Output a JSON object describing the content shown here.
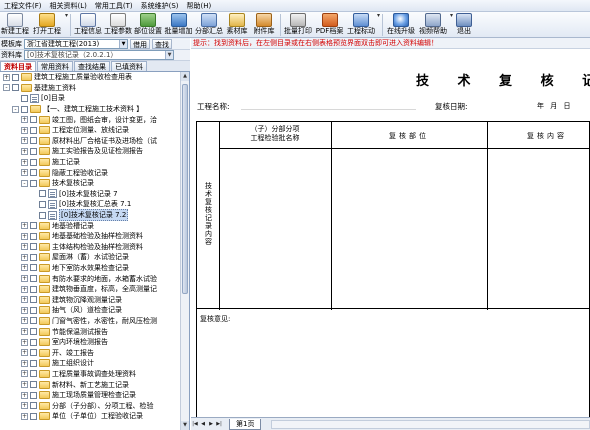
{
  "menu": [
    "工程文件(F)",
    "相关资料(L)",
    "常用工具(T)",
    "系统维护(S)",
    "帮助(H)"
  ],
  "toolbar": {
    "new_project": "新建工程",
    "open_project": "打开工程",
    "project_info": "工程信息",
    "project_params": "工程参数",
    "dept_settings": "部位设置",
    "batch_add": "批量增加",
    "sub_summary": "分部汇总",
    "material_lib": "素材库",
    "attachment_lib": "附件库",
    "batch_print": "批量打印",
    "pdf_archive": "PDF档案",
    "project_mark": "工程标动",
    "online_upgrade": "在线升级",
    "video_help": "视频帮助",
    "exit": "退出"
  },
  "left": {
    "template_label": "模板库",
    "template_value": "浙江省建筑工程(2013)",
    "template_button": "借用",
    "find_button": "查找",
    "library_label": "资料库",
    "library_value": "[0]技术复核记录（2.0.2.1）",
    "tabs": [
      "资料目录",
      "常用资料",
      "查找结果",
      "已填资料"
    ],
    "tree": [
      {
        "label": "建筑工程施工质量验收检查用表",
        "indent": 0,
        "type": "folder",
        "exp": "+"
      },
      {
        "label": "基建施工资料",
        "indent": 0,
        "type": "folder",
        "exp": "-"
      },
      {
        "label": "[0]目录",
        "indent": 1,
        "type": "doc",
        "exp": ""
      },
      {
        "label": "【一、建筑工程施工技术资料 】",
        "indent": 1,
        "type": "folder",
        "exp": "-"
      },
      {
        "label": "竣工图，图纸会审，设计变更，洽",
        "indent": 2,
        "type": "folder",
        "exp": "+"
      },
      {
        "label": "工程定位测量、放线记录",
        "indent": 2,
        "type": "folder",
        "exp": "+"
      },
      {
        "label": "原材料出厂合格证书及进场检（试",
        "indent": 2,
        "type": "folder",
        "exp": "+"
      },
      {
        "label": "施工实验报告及见证检测报告",
        "indent": 2,
        "type": "folder",
        "exp": "+"
      },
      {
        "label": "施工记录",
        "indent": 2,
        "type": "folder",
        "exp": "+"
      },
      {
        "label": "隐蔽工程验收记录",
        "indent": 2,
        "type": "folder",
        "exp": "+"
      },
      {
        "label": "技术复核记录",
        "indent": 2,
        "type": "folder",
        "exp": "-"
      },
      {
        "label": "[0]技术复核记录 7",
        "indent": 3,
        "type": "doc",
        "exp": ""
      },
      {
        "label": "[0]技术复核汇总表 7.1",
        "indent": 3,
        "type": "doc",
        "exp": ""
      },
      {
        "label": "[0]技术复核记录 7.2",
        "indent": 3,
        "type": "doc",
        "exp": "",
        "selected": true
      },
      {
        "label": "地基验槽记录",
        "indent": 2,
        "type": "folder",
        "exp": "+"
      },
      {
        "label": "地基基础检验及抽样检测资料",
        "indent": 2,
        "type": "folder",
        "exp": "+"
      },
      {
        "label": "主体结构检验及抽样检测资料",
        "indent": 2,
        "type": "folder",
        "exp": "+"
      },
      {
        "label": "屋面淋（蓄）水试验记录",
        "indent": 2,
        "type": "folder",
        "exp": "+"
      },
      {
        "label": "地下室防水效果检查记录",
        "indent": 2,
        "type": "folder",
        "exp": "+"
      },
      {
        "label": "有防水要求的地面，水箱蓄水试验",
        "indent": 2,
        "type": "folder",
        "exp": "+"
      },
      {
        "label": "建筑物垂直度，标高，全高测量记",
        "indent": 2,
        "type": "folder",
        "exp": "+"
      },
      {
        "label": "建筑物沉降观测量记录",
        "indent": 2,
        "type": "folder",
        "exp": "+"
      },
      {
        "label": "抽气（风）道检查记录",
        "indent": 2,
        "type": "folder",
        "exp": "+"
      },
      {
        "label": "门窗气密性，水密性，耐风压检测",
        "indent": 2,
        "type": "folder",
        "exp": "+"
      },
      {
        "label": "节能保温测试报告",
        "indent": 2,
        "type": "folder",
        "exp": "+"
      },
      {
        "label": "室内环境检测报告",
        "indent": 2,
        "type": "folder",
        "exp": "+"
      },
      {
        "label": "开、竣工报告",
        "indent": 2,
        "type": "folder",
        "exp": "+"
      },
      {
        "label": "施工组织设计",
        "indent": 2,
        "type": "folder",
        "exp": "+"
      },
      {
        "label": "工程质量事故调查处理资料",
        "indent": 2,
        "type": "folder",
        "exp": "+"
      },
      {
        "label": "新材料、新工艺施工记录",
        "indent": 2,
        "type": "folder",
        "exp": "+"
      },
      {
        "label": "施工现场质量管理检查记录",
        "indent": 2,
        "type": "folder",
        "exp": "+"
      },
      {
        "label": "分部（子分部）、分项工程、检验",
        "indent": 2,
        "type": "folder",
        "exp": "+"
      },
      {
        "label": "单位（子单位）工程验收记录",
        "indent": 2,
        "type": "folder",
        "exp": "+"
      }
    ]
  },
  "right": {
    "hint": "提示：找到资料后，在左侧目录或在右侧表格预览界面双击即可进入资料编辑！",
    "title": "技 术 复 核 记 录",
    "project_name_label": "工程名称:",
    "review_date_label": "复核日期:",
    "ymd": "年  月  日",
    "col1_line1": "（子）分部分项",
    "col1_line2": "工程检验批名称",
    "col2": "复核部位",
    "col3": "复核内容",
    "vertical_label": "技术复核记录内容",
    "opinion_label": "复核意见:",
    "sheet_tab": "第1页"
  }
}
